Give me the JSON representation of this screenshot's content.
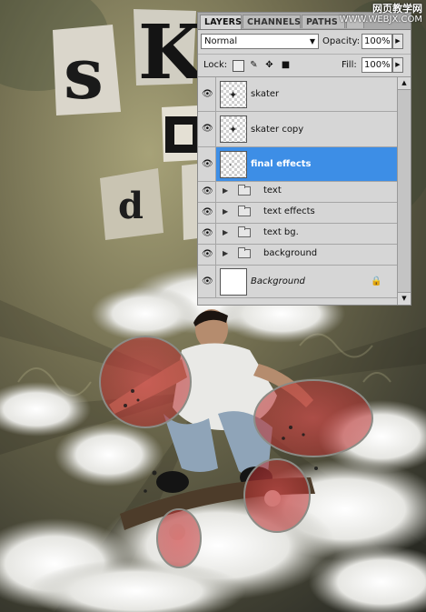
{
  "watermark": {
    "line1": "网页教学网",
    "line2": "WWW.WEBJX.COM"
  },
  "artwork": {
    "letter_s": "s",
    "letter_k": "K",
    "letter_d": "d",
    "letter_o": "o"
  },
  "panel": {
    "tabs": [
      {
        "label": "LAYERS",
        "active": true
      },
      {
        "label": "CHANNELS",
        "active": false
      },
      {
        "label": "PATHS",
        "active": false
      },
      {
        "label": "",
        "active": false
      }
    ],
    "blend_mode": "Normal",
    "opacity_label": "Opacity:",
    "opacity_value": "100%",
    "lock_label": "Lock:",
    "fill_label": "Fill:",
    "fill_value": "100%",
    "layers": [
      {
        "name": "skater",
        "type": "layer",
        "selected": false
      },
      {
        "name": "skater copy",
        "type": "layer",
        "selected": false
      },
      {
        "name": "final effects",
        "type": "layer",
        "selected": true
      },
      {
        "name": "text",
        "type": "group"
      },
      {
        "name": "text effects",
        "type": "group"
      },
      {
        "name": "text bg.",
        "type": "group"
      },
      {
        "name": "background",
        "type": "group"
      },
      {
        "name": "Background",
        "type": "background",
        "locked": true
      }
    ]
  },
  "colors": {
    "selection": "#3d8ee6",
    "panel_bg": "#d6d6d6",
    "tab_bar": "#a9a9a9"
  }
}
